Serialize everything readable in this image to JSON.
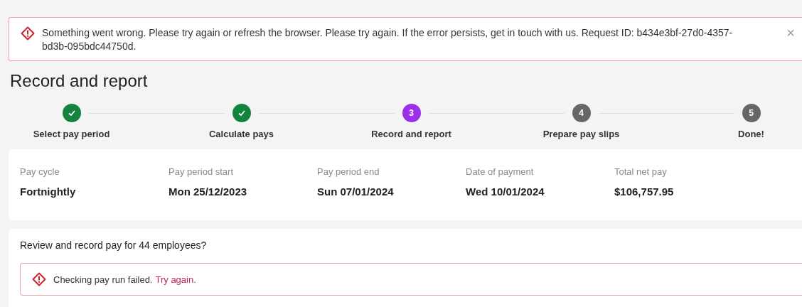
{
  "alert": {
    "message": "Something went wrong. Please try again or refresh the browser. Please try again. If the error persists, get in touch with us. Request ID: b434e3bf-27d0-4357-bd3b-095bdc44750d.",
    "close": "×"
  },
  "title": "Record and report",
  "steps": [
    {
      "label": "Select pay period",
      "completed": true,
      "selected": false
    },
    {
      "label": "Calculate pays",
      "completed": true,
      "selected": false
    },
    {
      "label": "Record and report",
      "number": "3",
      "completed": false,
      "selected": true
    },
    {
      "label": "Prepare pay slips",
      "number": "4",
      "completed": false,
      "selected": false
    },
    {
      "label": "Done!",
      "number": "5",
      "completed": false,
      "selected": false
    }
  ],
  "summary": [
    {
      "label": "Pay cycle",
      "value": "Fortnightly"
    },
    {
      "label": "Pay period start",
      "value": "Mon 25/12/2023"
    },
    {
      "label": "Pay period end",
      "value": "Sun 07/01/2024"
    },
    {
      "label": "Date of payment",
      "value": "Wed 10/01/2024"
    },
    {
      "label": "Total net pay",
      "value": "$106,757.95"
    }
  ],
  "review": {
    "question": "Review and record pay for 44 employees?",
    "error": "Checking pay run failed.",
    "link": "Try again."
  }
}
